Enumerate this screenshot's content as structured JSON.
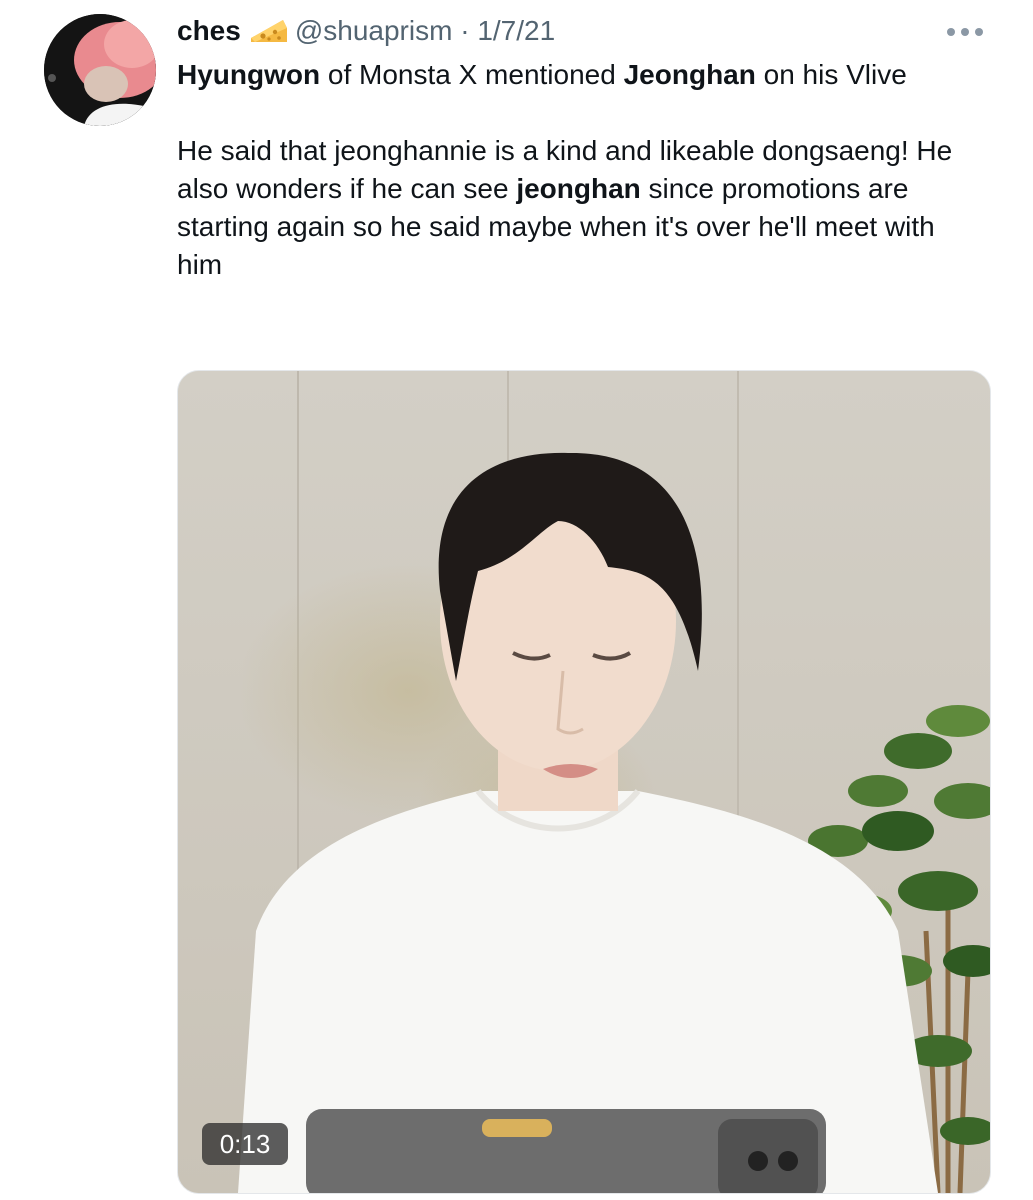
{
  "tweet": {
    "author": {
      "display_name": "ches",
      "name_emoji": "cheese-icon",
      "handle": "@shuaprism",
      "separator": "·",
      "date": "1/7/21"
    },
    "more_menu_icon": "more-horizontal-icon",
    "text": {
      "p1": {
        "bold1": "Hyungwon",
        "mid": " of Monsta X mentioned ",
        "bold2": "Jeonghan",
        "end": " on his Vlive"
      },
      "p2": {
        "start": "He said that jeonghannie is a kind and likeable dongsaeng! He also wonders if he can see ",
        "bold": "jeonghan",
        "end": " since promotions are starting again so he said maybe when it's over he'll meet with him"
      }
    },
    "media": {
      "type": "video",
      "duration": "0:13"
    }
  },
  "colors": {
    "text": "#0f1419",
    "secondary": "#536471",
    "background": "#ffffff",
    "cheese": "#f5b942"
  }
}
